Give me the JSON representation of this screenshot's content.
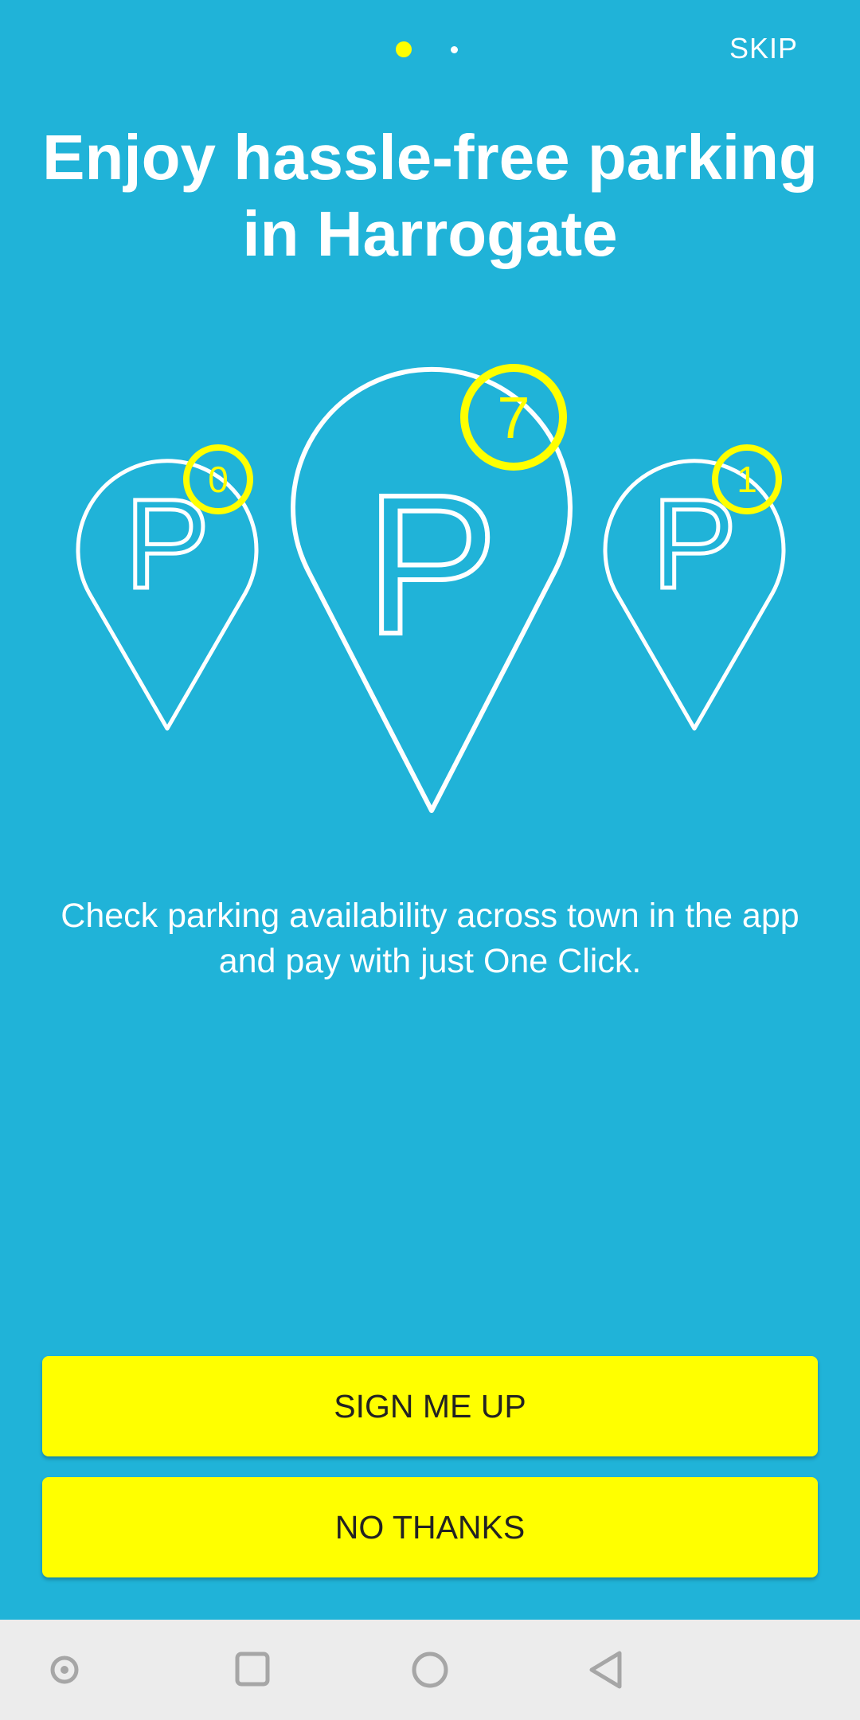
{
  "pager": {
    "total_pages": 2,
    "current_page": 1,
    "active_color": "#ffff00",
    "inactive_color": "#ffffff"
  },
  "header": {
    "skip_label": "SKIP"
  },
  "onboarding": {
    "title": "Enjoy hassle-free parking in Harrogate",
    "description": "Check parking availability across town in the app and pay with just One Click.",
    "pins": [
      {
        "letter": "P",
        "count": "0"
      },
      {
        "letter": "P",
        "count": "7"
      },
      {
        "letter": "P",
        "count": "1"
      }
    ]
  },
  "actions": {
    "sign_up_label": "SIGN ME UP",
    "no_thanks_label": "NO THANKS"
  },
  "system_nav": {
    "icons": [
      "assistant-dot-icon",
      "recents-square-icon",
      "home-circle-icon",
      "back-triangle-icon"
    ]
  },
  "colors": {
    "background": "#20b3d8",
    "accent": "#ffff00",
    "button_text": "#222222",
    "navbar": "#ececec"
  }
}
